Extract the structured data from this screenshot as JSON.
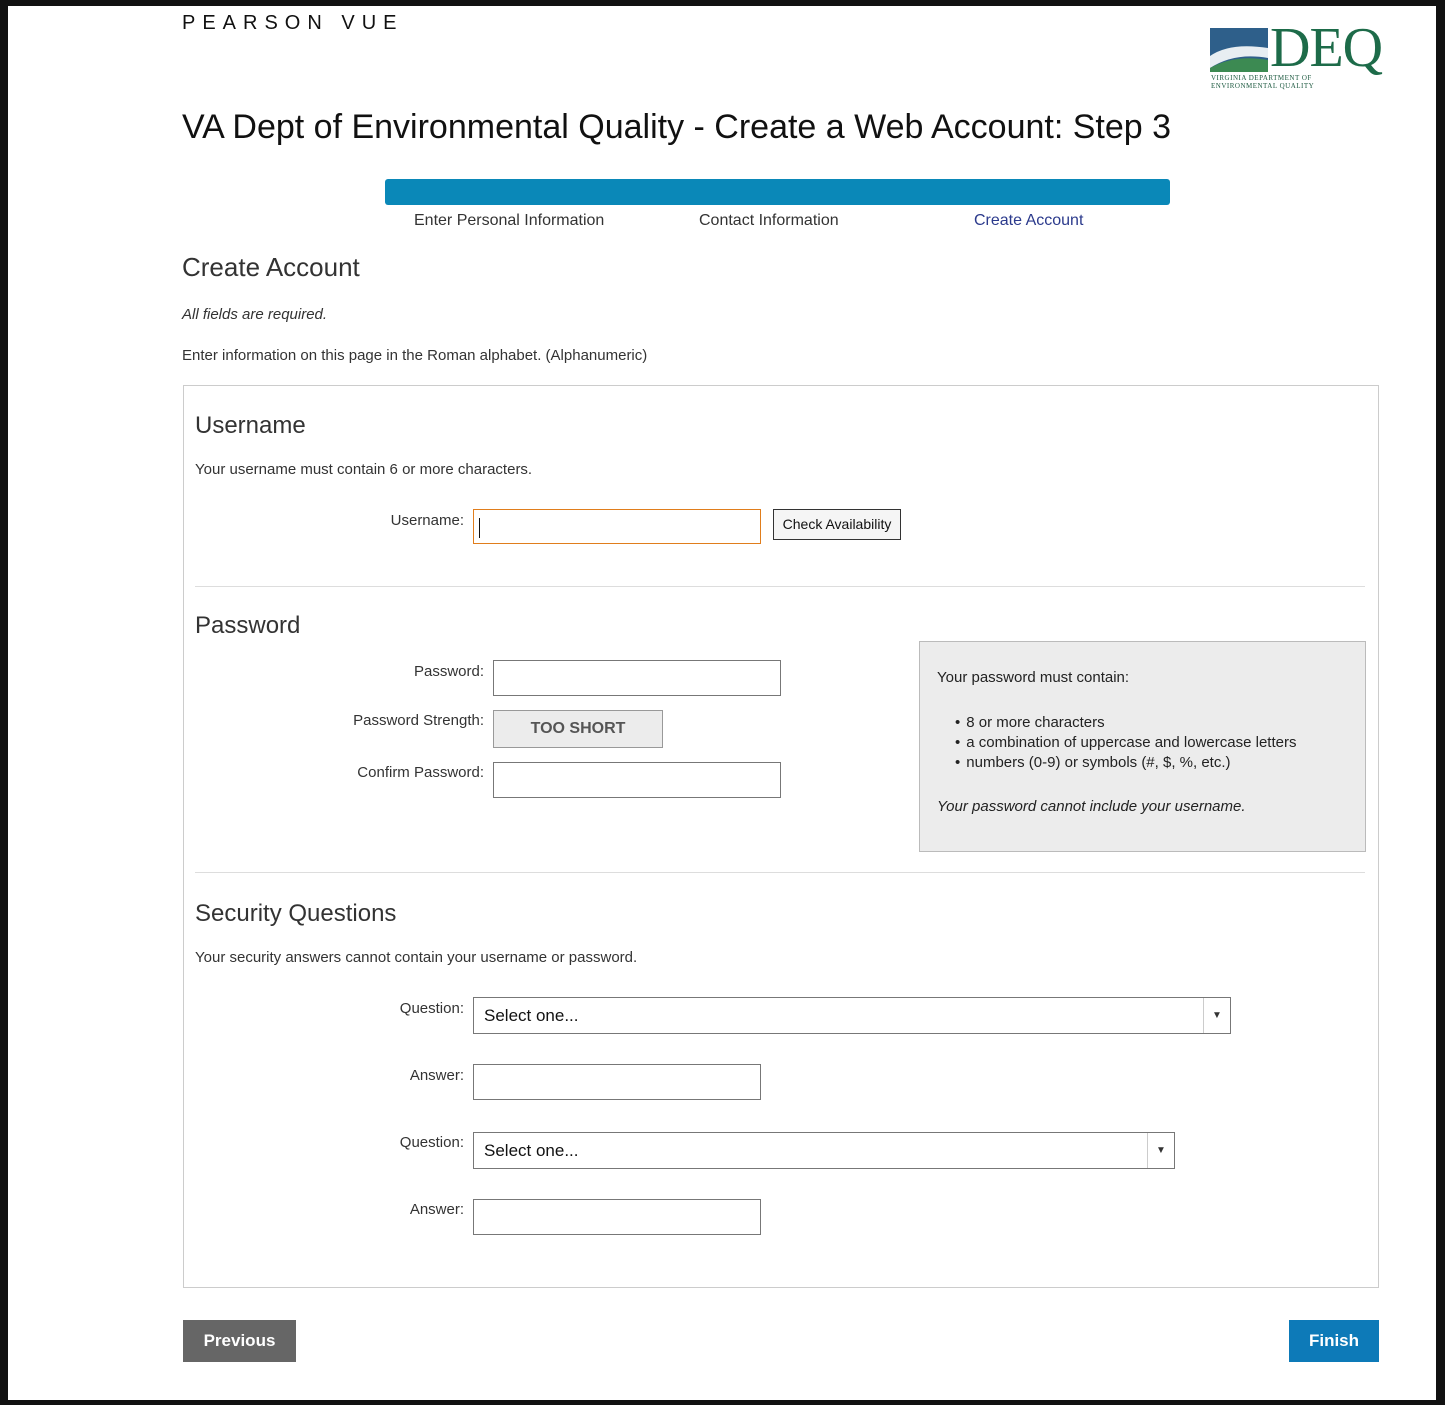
{
  "header": {
    "brand": "PEARSON VUE",
    "logo_text": "DEQ",
    "logo_sub_line1": "VIRGINIA DEPARTMENT OF",
    "logo_sub_line2": "ENVIRONMENTAL QUALITY",
    "title": "VA Dept of Environmental Quality - Create a Web Account: Step 3"
  },
  "steps": [
    {
      "label": "Enter Personal Information"
    },
    {
      "label": "Contact Information"
    },
    {
      "label": "Create Account"
    }
  ],
  "page": {
    "heading": "Create Account",
    "required_note": "All fields are required.",
    "alphabet_note": "Enter information on this page in the Roman alphabet. (Alphanumeric)"
  },
  "username": {
    "heading": "Username",
    "hint": "Your username must contain 6 or more characters.",
    "label": "Username:",
    "check_button": "Check Availability"
  },
  "password": {
    "heading": "Password",
    "password_label": "Password:",
    "strength_label": "Password Strength:",
    "strength_value": "TOO SHORT",
    "confirm_label": "Confirm Password:",
    "rules_title": "Your password must contain:",
    "rules": [
      "8 or more characters",
      "a combination of uppercase and lowercase letters",
      "numbers (0-9) or symbols (#, $, %, etc.)"
    ],
    "rules_warning": "Your password cannot include your username."
  },
  "security": {
    "heading": "Security Questions",
    "hint": "Your security answers cannot contain your username or password.",
    "question_label": "Question:",
    "answer_label": "Answer:",
    "select_placeholder": "Select one..."
  },
  "buttons": {
    "previous": "Previous",
    "finish": "Finish"
  },
  "colors": {
    "progress_bar": "#0a88b8",
    "active_step": "#2b3a8c",
    "finish_button": "#0d7ab8",
    "previous_button": "#666666",
    "focus_border": "#e07d1c"
  }
}
